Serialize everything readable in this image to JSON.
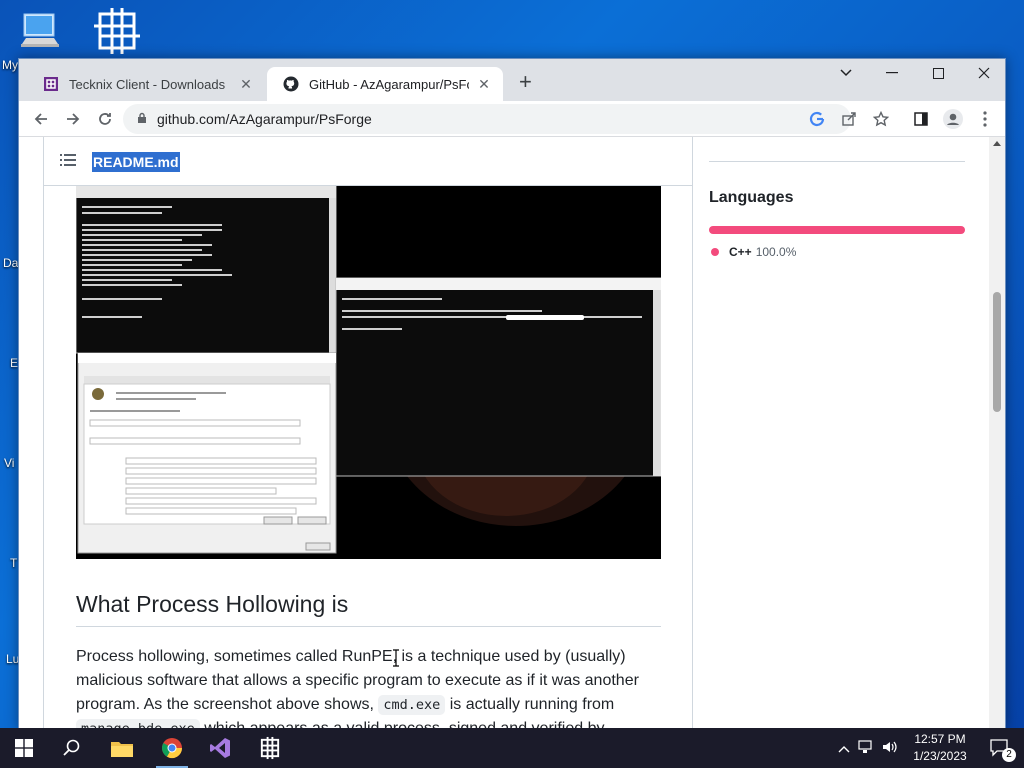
{
  "desktop": {
    "icons": [
      {
        "name": "this-pc",
        "label": "My"
      },
      {
        "name": "tecknix-client",
        "label": ""
      }
    ],
    "side_labels": [
      "Da",
      "E",
      "Vi",
      "T",
      "Lu"
    ]
  },
  "browser": {
    "tabs": [
      {
        "title": "Tecknix Client - Downloads",
        "active": false
      },
      {
        "title": "GitHub - AzAgarampur/PsForge",
        "active": true
      }
    ],
    "newtab_label": "+",
    "address": "github.com/AzAgarampur/PsForge",
    "controls": {
      "dropdown": "⌄",
      "minimize": "—",
      "maximize": "☐",
      "close": "✕"
    }
  },
  "page": {
    "readme_file": "README.md",
    "section_heading": "What Process Hollowing is",
    "paragraph": {
      "text1": "Process hollowing, sometimes called RunPE, is a technique used by (usually) malicious software that allows a specific program to execute as if it was another program. As the screenshot above shows, ",
      "code1": "cmd.exe",
      "text2": " is actually running from ",
      "code2": "manage-bde.exe",
      "text3": " which appears as a valid process, signed and verified by Microsoft."
    },
    "sidebar": {
      "languages_title": "Languages",
      "language_name": "C++",
      "language_percent": "100.0%",
      "language_color": "#f34b7d"
    }
  },
  "taskbar": {
    "time": "12:57 PM",
    "date": "1/23/2023",
    "notification_count": "2"
  }
}
